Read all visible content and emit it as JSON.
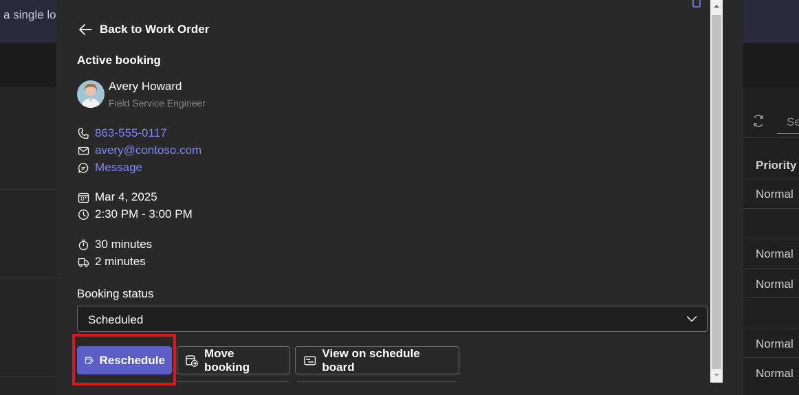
{
  "background": {
    "topbar_text": "a single lo",
    "search_placeholder": "Se",
    "column_header": "Priority",
    "rows": [
      "Normal",
      "Normal",
      "Normal",
      "Normal",
      "Normal"
    ]
  },
  "dialog": {
    "back_label": "Back to Work Order",
    "section_title": "Active booking",
    "person": {
      "name": "Avery Howard",
      "role": "Field Service Engineer"
    },
    "contact": {
      "phone": "863-555-0117",
      "email": "avery@contoso.com",
      "message": "Message"
    },
    "schedule": {
      "date": "Mar 4, 2025",
      "time": "2:30 PM - 3:00 PM"
    },
    "durations": {
      "duration": "30 minutes",
      "travel": "2 minutes"
    },
    "status": {
      "label": "Booking status",
      "value": "Scheduled"
    },
    "actions": {
      "reschedule": "Reschedule",
      "move": "Move booking",
      "board": "View on schedule board"
    }
  },
  "colors": {
    "accent": "#5b5fc7",
    "link": "#7f85f5",
    "highlight": "#e0141c"
  },
  "icons": [
    "arrow-left-icon",
    "phone-icon",
    "mail-icon",
    "chat-icon",
    "calendar-icon",
    "clock-icon",
    "timer-icon",
    "vehicle-icon",
    "chevron-down-icon",
    "edit-calendar-icon",
    "move-calendar-icon",
    "board-icon",
    "refresh-icon",
    "copy-icon"
  ]
}
